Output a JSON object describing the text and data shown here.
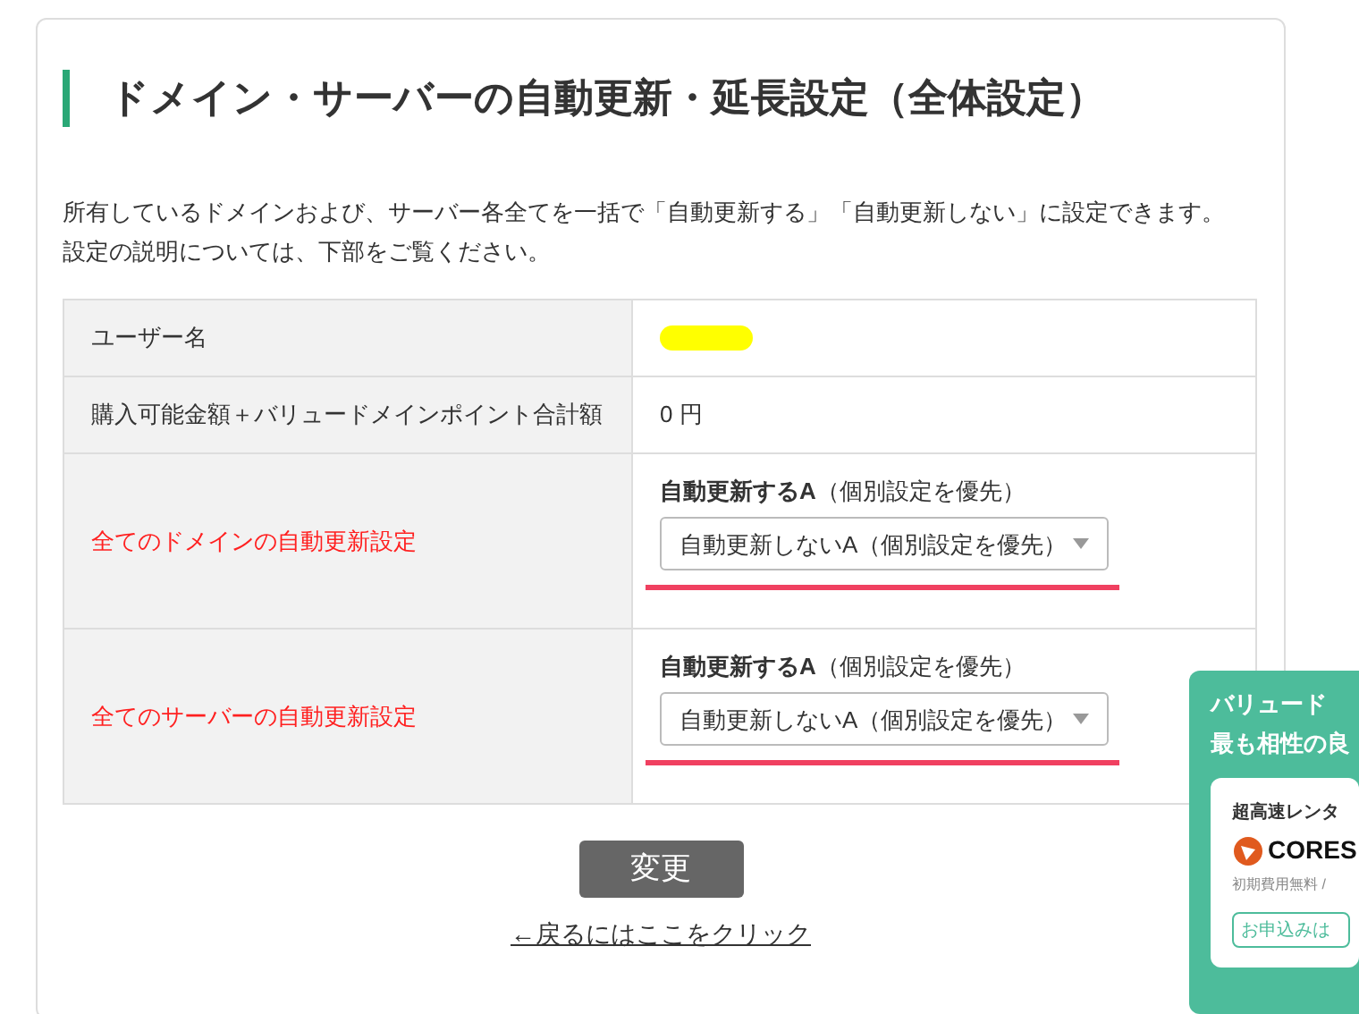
{
  "title": "ドメイン・サーバーの自動更新・延長設定（全体設定）",
  "description": [
    "所有しているドメインおよび、サーバー各全てを一括で「自動更新する」「自動更新しない」に設定できます。",
    "設定の説明については、下部をご覧ください。"
  ],
  "rows": [
    {
      "kind": "redacted",
      "label": "ユーザー名",
      "highlight": false
    },
    {
      "kind": "text",
      "label": "購入可能金額＋バリュードメインポイント合計額",
      "value": "0 円",
      "highlight": false
    },
    {
      "kind": "select",
      "label": "全てのドメインの自動更新設定",
      "highlight": true,
      "current": "**自動更新するA**（個別設定を優先）",
      "select_value": "自動更新しないA（個別設定を優先）"
    },
    {
      "kind": "select",
      "label": "全てのサーバーの自動更新設定",
      "highlight": true,
      "current": "**自動更新するA**（個別設定を優先）",
      "select_value": "自動更新しないA（個別設定を優先）"
    }
  ],
  "submit": "変更",
  "back_link": "←戻るにはここをクリック",
  "ad": {
    "heading": [
      "バリュード",
      "最も相性の良"
    ],
    "card_title": "超高速レンタ",
    "brand": "CORES",
    "note": "初期費用無料 / ",
    "button": "お申込みは"
  }
}
